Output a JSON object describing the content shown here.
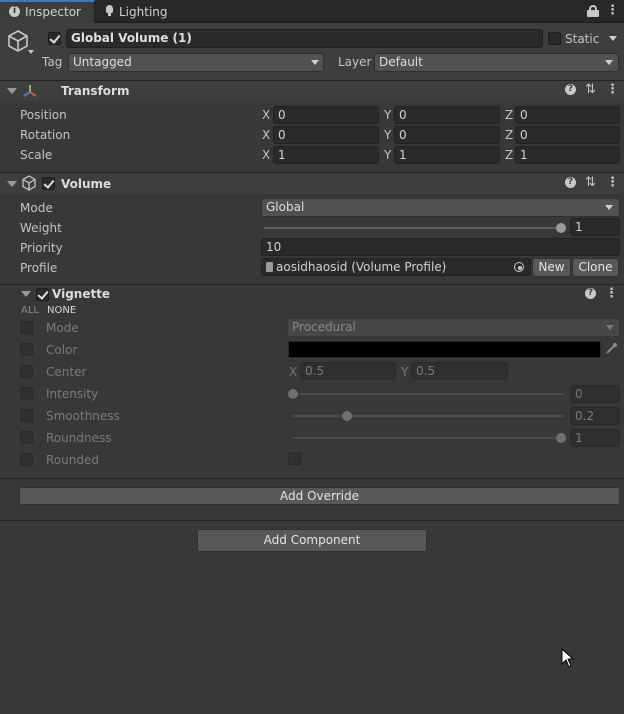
{
  "tabs": [
    {
      "label": "Inspector",
      "icon": "info-icon"
    },
    {
      "label": "Lighting",
      "icon": "lightbulb-icon"
    }
  ],
  "gameobject": {
    "name": "Global Volume (1)",
    "active": true,
    "static_label": "Static",
    "static": false,
    "tag_label": "Tag",
    "tag_value": "Untagged",
    "layer_label": "Layer",
    "layer_value": "Default"
  },
  "transform": {
    "title": "Transform",
    "rows": [
      {
        "label": "Position",
        "x": "0",
        "y": "0",
        "z": "0"
      },
      {
        "label": "Rotation",
        "x": "0",
        "y": "0",
        "z": "0"
      },
      {
        "label": "Scale",
        "x": "1",
        "y": "1",
        "z": "1"
      }
    ],
    "axis": {
      "x": "X",
      "y": "Y",
      "z": "Z"
    }
  },
  "volume": {
    "title": "Volume",
    "enabled": true,
    "mode_label": "Mode",
    "mode_value": "Global",
    "weight_label": "Weight",
    "weight_value": "1",
    "weight_fraction": 1.0,
    "priority_label": "Priority",
    "priority_value": "10",
    "profile_label": "Profile",
    "profile_value": "aosidhaosid (Volume Profile)",
    "new_label": "New",
    "clone_label": "Clone"
  },
  "vignette": {
    "title": "Vignette",
    "enabled": true,
    "all_label": "ALL",
    "none_label": "NONE",
    "mode_label": "Mode",
    "mode_value": "Procedural",
    "color_label": "Color",
    "color_value": "#000000",
    "center_label": "Center",
    "center_x": "0.5",
    "center_y": "0.5",
    "intensity_label": "Intensity",
    "intensity_value": "0",
    "intensity_fraction": 0.0,
    "smoothness_label": "Smoothness",
    "smoothness_value": "0.2",
    "smoothness_fraction": 0.2,
    "roundness_label": "Roundness",
    "roundness_value": "1",
    "roundness_fraction": 1.0,
    "rounded_label": "Rounded"
  },
  "add_override_label": "Add Override",
  "add_component_label": "Add Component",
  "colors": {
    "accent": "#3a79bb",
    "panel": "#383838",
    "field": "#2a2a2a"
  }
}
